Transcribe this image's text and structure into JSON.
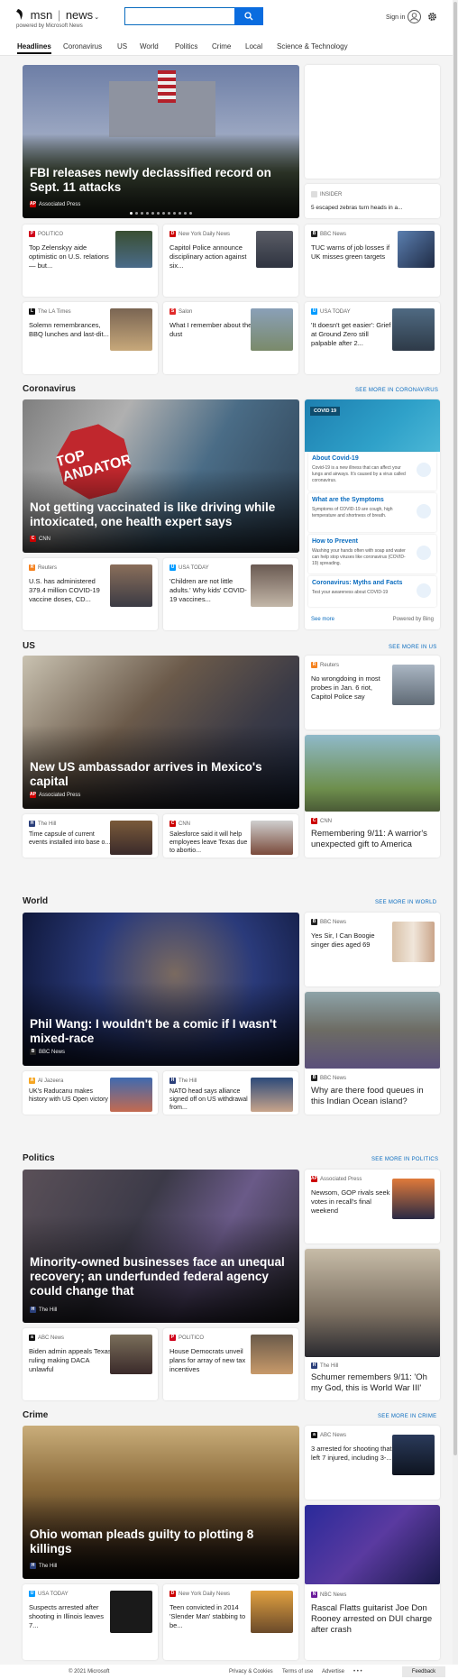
{
  "header": {
    "logo": "msn",
    "news": "news",
    "powered": "powered by Microsoft News",
    "signin": "Sign in",
    "search_placeholder": ""
  },
  "nav": [
    "Headlines",
    "Coronavirus",
    "US",
    "World",
    "Politics",
    "Crime",
    "Local",
    "Science & Technology"
  ],
  "top": {
    "hero": {
      "title": "FBI releases newly declassified record on Sept. 11 attacks",
      "source": "Associated Press"
    },
    "side_source": "INSIDER",
    "side_title": "5 escaped zebras turn heads in a...",
    "row1": [
      {
        "source": "POLITICO",
        "title": "Top Zelenskyy aide optimistic on U.S. relations — but..."
      },
      {
        "source": "New York Daily News",
        "title": "Capitol Police announce disciplinary action against six..."
      },
      {
        "source": "BBC News",
        "title": "TUC warns of job losses if UK misses green targets"
      }
    ],
    "row2": [
      {
        "source": "The LA Times",
        "title": "Solemn remembrances, BBQ lunches and last-dit..."
      },
      {
        "source": "Salon",
        "title": "What I remember about the dust"
      },
      {
        "source": "USA TODAY",
        "title": "'It doesn't get easier': Grief at Ground Zero still palpable after 2..."
      }
    ]
  },
  "coronavirus": {
    "heading": "Coronavirus",
    "more": "SEE MORE IN CORONAVIRUS",
    "hero": {
      "title": "Not getting vaccinated is like driving while intoxicated, one health expert says",
      "source": "CNN",
      "sign_text": "STOP MANDATORY"
    },
    "row": [
      {
        "source": "Reuters",
        "title": "U.S. has administered 379.4 million COVID-19 vaccine doses, CD..."
      },
      {
        "source": "USA TODAY",
        "title": "'Children are not little adults.' Why kids' COVID-19 vaccines..."
      }
    ],
    "panel": {
      "tag": "COVID 19",
      "items": [
        {
          "title": "About Covid-19",
          "desc": "Covid-19 is a new illness that can affect your lungs and airways. It's caused by a virus called coronavirus."
        },
        {
          "title": "What are the Symptoms",
          "desc": "Symptoms of COVID-19 are cough, high temperature and shortness of breath."
        },
        {
          "title": "How to Prevent",
          "desc": "Washing your hands often with soap and water can help stop viruses like coronavirus (COVID-19) spreading."
        },
        {
          "title": "Coronavirus: Myths and Facts",
          "desc": "Test your awareness about COVID-19"
        }
      ],
      "see_more": "See more",
      "powered": "Powered by Bing"
    }
  },
  "us": {
    "heading": "US",
    "more": "SEE MORE IN US",
    "hero": {
      "title": "New US ambassador arrives in Mexico's capital",
      "source": "Associated Press"
    },
    "side": {
      "source": "Reuters",
      "title": "No wrongdoing in most probes in Jan. 6 riot, Capitol Police say"
    },
    "big": {
      "source": "CNN",
      "title": "Remembering 9/11: A warrior's unexpected gift to America"
    },
    "row": [
      {
        "source": "The Hill",
        "title": "Time capsule of current events installed into base o..."
      },
      {
        "source": "CNN",
        "title": "Salesforce said it will help employees leave Texas due to abortio..."
      }
    ]
  },
  "world": {
    "heading": "World",
    "more": "SEE MORE IN WORLD",
    "hero": {
      "title": "Phil Wang: I wouldn't be a comic if I wasn't mixed-race",
      "source": "BBC News"
    },
    "side": {
      "source": "BBC News",
      "title": "Yes Sir, I Can Boogie singer dies aged 69"
    },
    "big": {
      "source": "BBC News",
      "title": "Why are there food queues in this Indian Ocean island?"
    },
    "row": [
      {
        "source": "Al Jazeera",
        "title": "UK's Raducanu makes history with US Open victory"
      },
      {
        "source": "The Hill",
        "title": "NATO head says alliance signed off on US withdrawal from..."
      }
    ]
  },
  "politics": {
    "heading": "Politics",
    "more": "SEE MORE IN POLITICS",
    "hero": {
      "title": "Minority-owned businesses face an unequal recovery; an underfunded federal agency could change that",
      "source": "The Hill"
    },
    "side": {
      "source": "Associated Press",
      "title": "Newsom, GOP rivals seek votes in recall's final weekend"
    },
    "big": {
      "source": "The Hill",
      "title": "Schumer remembers 9/11: 'Oh my God, this is World War III'"
    },
    "row": [
      {
        "source": "ABC News",
        "title": "Biden admin appeals Texas ruling making DACA unlawful"
      },
      {
        "source": "POLITICO",
        "title": "House Democrats unveil plans for array of new tax incentives"
      }
    ]
  },
  "crime": {
    "heading": "Crime",
    "more": "SEE MORE IN CRIME",
    "hero": {
      "title": "Ohio woman pleads guilty to plotting 8 killings",
      "source": "The Hill"
    },
    "side": {
      "source": "ABC News",
      "title": "3 arrested for shooting that left 7 injured, including 3-..."
    },
    "big": {
      "source": "NBC News",
      "title": "Rascal Flatts guitarist Joe Don Rooney arrested on DUI charge after crash"
    },
    "row": [
      {
        "source": "USA TODAY",
        "title": "Suspects arrested after shooting in Illinois leaves 7..."
      },
      {
        "source": "New York Daily News",
        "title": "Teen convicted in 2014 'Slender Man' stabbing to be..."
      }
    ]
  },
  "footer": {
    "copyright": "© 2021 Microsoft",
    "privacy": "Privacy & Cookies",
    "terms": "Terms of use",
    "advertise": "Advertise",
    "dots": "• • •",
    "feedback": "Feedback"
  },
  "colors": {
    "accent": "#0a6cbf",
    "search_button": "#0a6cdf"
  }
}
